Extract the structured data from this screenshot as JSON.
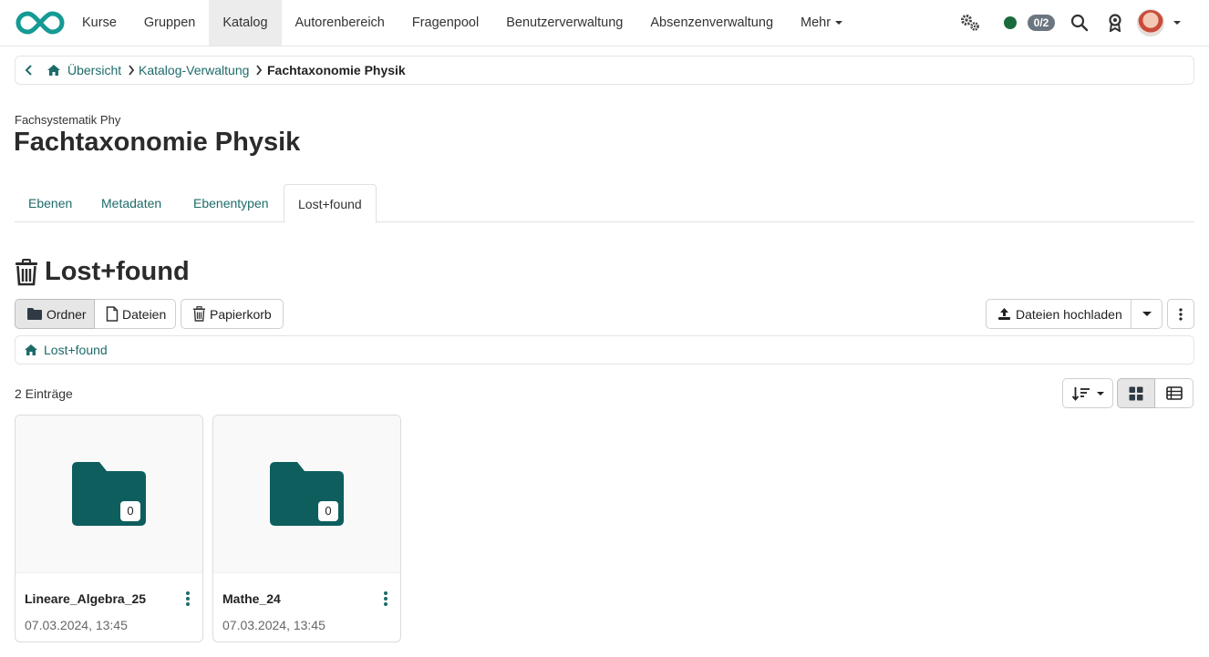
{
  "nav": {
    "items": [
      "Kurse",
      "Gruppen",
      "Katalog",
      "Autorenbereich",
      "Fragenpool",
      "Benutzerverwaltung",
      "Absenzenverwaltung",
      "Mehr"
    ],
    "active": "Katalog",
    "status_badge": "0/2",
    "icons": [
      "infinity-logo",
      "gears-icon",
      "online-status-dot",
      "search-icon",
      "badge-icon",
      "avatar"
    ]
  },
  "breadcrumb": {
    "items": [
      "Übersicht",
      "Katalog-Verwaltung"
    ],
    "current": "Fachtaxonomie Physik"
  },
  "header": {
    "subtitle": "Fachsystematik Phy",
    "title": "Fachtaxonomie Physik"
  },
  "tabs": [
    "Ebenen",
    "Metadaten",
    "Ebenentypen",
    "Lost+found"
  ],
  "section": {
    "title": "Lost+found",
    "view_buttons": [
      "Ordner",
      "Dateien",
      "Papierkorb"
    ],
    "upload_label": "Dateien hochladen",
    "path_label": "Lost+found",
    "count_label": "2 Einträge"
  },
  "cards": [
    {
      "name": "Lineare_Algebra_25",
      "date": "07.03.2024, 13:45",
      "count": "0"
    },
    {
      "name": "Mathe_24",
      "date": "07.03.2024, 13:45",
      "count": "0"
    }
  ],
  "colors": {
    "accent": "#1d6b69",
    "folder": "#0e5e5e",
    "online": "#1a6b3c"
  }
}
